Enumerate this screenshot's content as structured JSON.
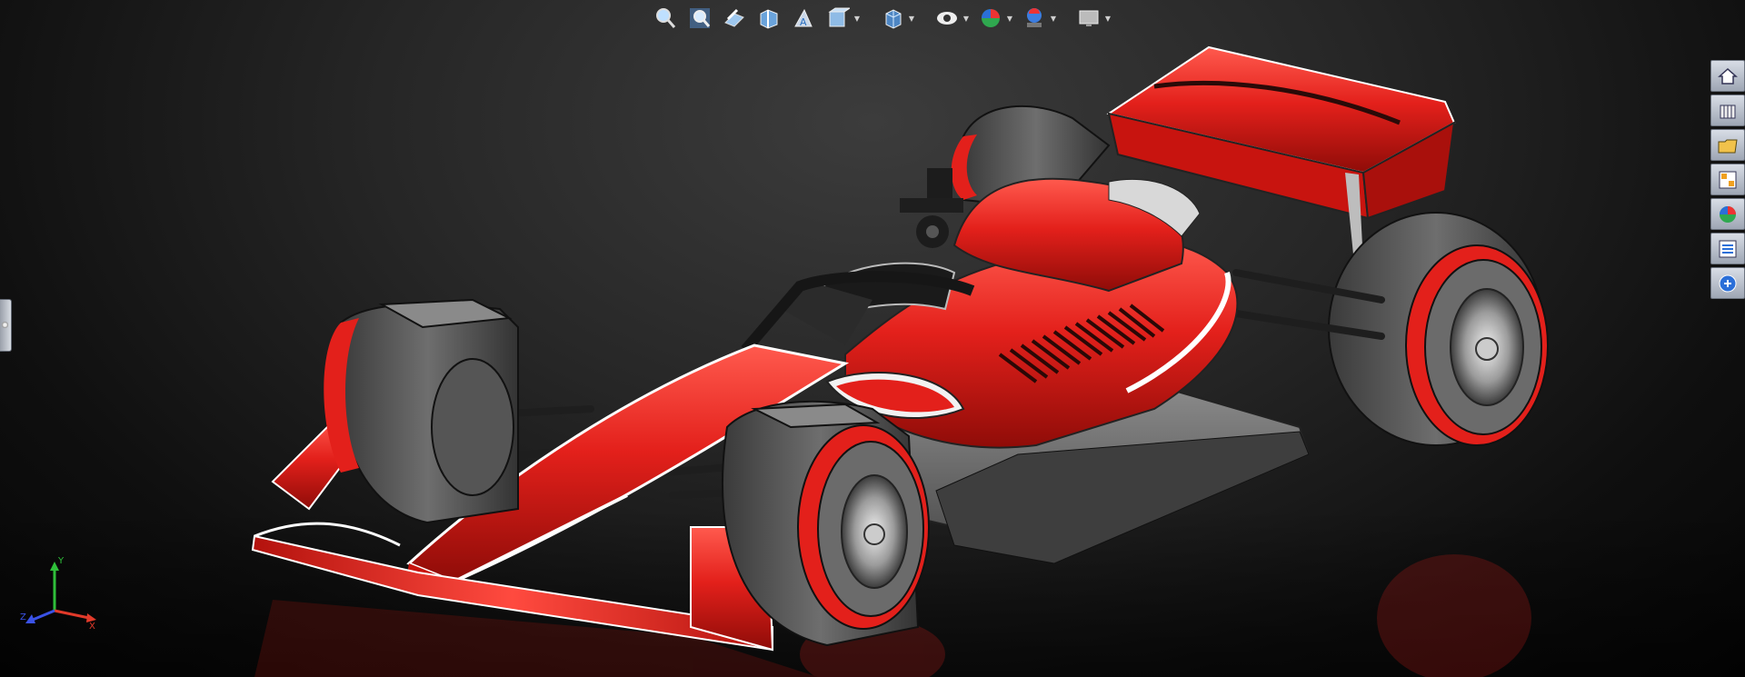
{
  "toolbar": {
    "icons": [
      "zoom-to-fit-icon",
      "zoom-to-area-icon",
      "previous-view-icon",
      "section-view-icon",
      "dynamic-annotation-icon",
      "view-orientation-icon",
      "display-style-icon",
      "hide-show-items-icon",
      "edit-appearance-icon",
      "apply-scene-icon",
      "view-settings-icon"
    ]
  },
  "taskpane": {
    "tabs": [
      "solidworks-resources-icon",
      "design-library-icon",
      "file-explorer-icon",
      "view-palette-icon",
      "appearances-scenes-icon",
      "custom-properties-icon",
      "solidworks-forum-icon"
    ]
  },
  "triad": {
    "x_label": "X",
    "y_label": "Y",
    "z_label": "Z",
    "x_color": "#e23a2a",
    "y_color": "#2fbf3a",
    "z_color": "#3a52e6"
  },
  "colors": {
    "car_red": "#e3201b",
    "tire": "#5a5a5a",
    "floor": "#6a6a6a"
  }
}
